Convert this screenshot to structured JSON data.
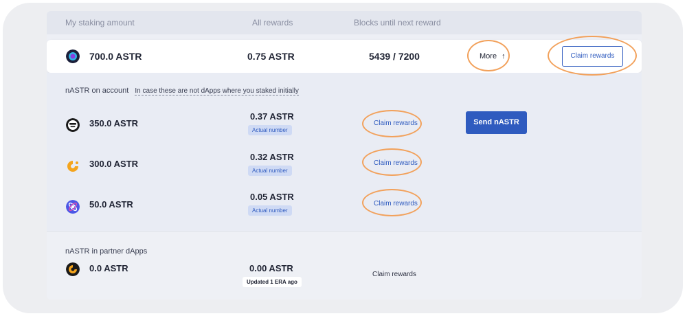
{
  "header": {
    "col_staking": "My staking amount",
    "col_rewards": "All rewards",
    "col_blocks": "Blocks until next reward"
  },
  "main_row": {
    "amount": "700.0 ASTR",
    "rewards": "0.75 ASTR",
    "blocks": "5439 / 7200",
    "more_label": "More",
    "more_arrow": "↑",
    "claim_label": "Claim rewards"
  },
  "nastr_account": {
    "title": "nASTR on account",
    "hint": "In case these are not dApps where you staked initially",
    "send_label": "Send nASTR",
    "rows": [
      {
        "amount": "350.0 ASTR",
        "reward": "0.37 ASTR",
        "badge": "Actual number",
        "claim": "Claim rewards",
        "icon": "monkey-icon"
      },
      {
        "amount": "300.0 ASTR",
        "reward": "0.32 ASTR",
        "badge": "Actual number",
        "claim": "Claim rewards",
        "icon": "orange-c-icon"
      },
      {
        "amount": "50.0 ASTR",
        "reward": "0.05 ASTR",
        "badge": "Actual number",
        "claim": "Claim rewards",
        "icon": "blue-atom-icon"
      }
    ]
  },
  "partner": {
    "title": "nASTR in partner dApps",
    "amount": "0.0 ASTR",
    "reward": "0.00 ASTR",
    "badge": "Updated 1 ERA ago",
    "claim": "Claim rewards"
  },
  "colors": {
    "accent": "#2f5bbf",
    "highlight": "#f2a15b"
  }
}
